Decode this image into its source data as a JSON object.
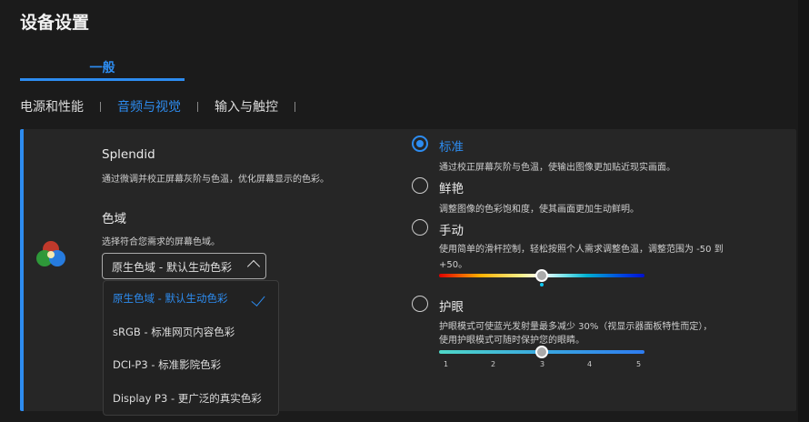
{
  "header": {
    "title": "设备设置"
  },
  "main_tab": {
    "label": "一般"
  },
  "sub_tabs": [
    {
      "label": "电源和性能",
      "active": false
    },
    {
      "label": "音频与视觉",
      "active": true
    },
    {
      "label": "输入与触控",
      "active": false
    }
  ],
  "splendid": {
    "title": "Splendid",
    "description": "通过微调并校正屏幕灰阶与色温，优化屏幕显示的色彩。"
  },
  "gamut": {
    "title": "色域",
    "description": "选择符合您需求的屏幕色域。",
    "selected": "原生色域 - 默认生动色彩",
    "options": [
      "原生色域 - 默认生动色彩",
      "sRGB - 标准网页内容色彩",
      "DCI-P3 - 标准影院色彩",
      "Display P3 - 更广泛的真实色彩"
    ]
  },
  "modes": [
    {
      "label": "标准",
      "description": "通过校正屏幕灰阶与色温，使输出图像更加贴近现实画面。",
      "selected": true
    },
    {
      "label": "鲜艳",
      "description": "调整图像的色彩饱和度，使其画面更加生动鲜明。",
      "selected": false
    },
    {
      "label": "手动",
      "description": "使用简单的滑杆控制，轻松按照个人需求调整色温，调整范围为 -50 到",
      "description2": "+50。",
      "selected": false,
      "slider_value": 0,
      "slider_range": [
        -50,
        50
      ]
    },
    {
      "label": "护眼",
      "description": "护眼模式可使蓝光发射量最多减少 30%（视显示器面板特性而定），",
      "description2": "使用护眼模式可随时保护您的眼睛。",
      "selected": false,
      "slider_value": 3,
      "ticks": [
        "1",
        "2",
        "3",
        "4",
        "5"
      ]
    }
  ],
  "colors": {
    "accent": "#2d8cf0",
    "card": "#262626",
    "background": "#1b1b1b"
  }
}
